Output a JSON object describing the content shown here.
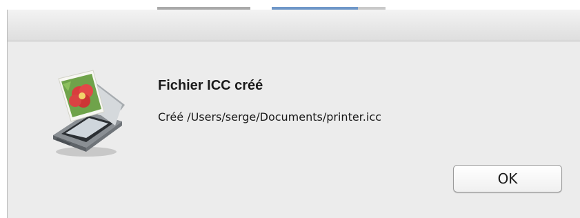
{
  "dialog": {
    "title": "Fichier ICC créé",
    "message": "Créé /Users/serge/Documents/printer.icc",
    "ok_label": "OK",
    "icon": "scanner-app-icon"
  },
  "colors": {
    "sheet_background": "#ececec",
    "background_tab_active": "#6f97c8"
  }
}
